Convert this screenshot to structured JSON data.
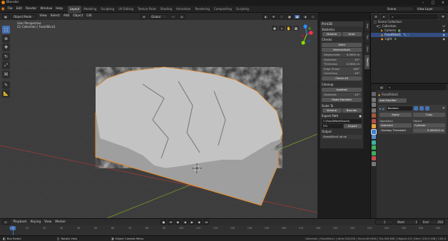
{
  "app": {
    "title": "Blender"
  },
  "topbar": {
    "menus": [
      "File",
      "Edit",
      "Render",
      "Window",
      "Help"
    ],
    "workspaces": [
      "Layout",
      "Modeling",
      "Sculpting",
      "UV Editing",
      "Texture Paint",
      "Shading",
      "Animation",
      "Rendering",
      "Compositing",
      "Scripting"
    ],
    "active_workspace": "Layout",
    "scene": "Scene",
    "view_layer": "View Layer"
  },
  "viewport": {
    "mode": "Object Mode",
    "menus": [
      "View",
      "Select",
      "Add",
      "Object"
    ],
    "gis": "GIS",
    "orientation": "Global",
    "view_name": "User Perspective",
    "collection_info": "(1) Collection | FossilSlice1"
  },
  "npanel": {
    "header": "Print3D",
    "statistics": "Statistics",
    "volume_btn": "Volume",
    "area_btn": "Area",
    "checks": "Checks",
    "solid_btn": "Solid",
    "intersections_btn": "Intersections",
    "rows": [
      {
        "label": "Degenerate",
        "value": "0.0001 m"
      },
      {
        "label": "Distorted",
        "value": "45°"
      },
      {
        "label": "Thickness",
        "value": "0.0001 m"
      },
      {
        "label": "Edge Sharp",
        "value": "160°"
      },
      {
        "label": "Overhang",
        "value": "45°"
      }
    ],
    "check_all_btn": "Check All",
    "cleanup": "Cleanup",
    "isolated_btn": "Isolated",
    "distorted_label": "Distorted",
    "distorted_value": "45°",
    "make_manifold_btn": "Make Manifold",
    "scale_to": "Scale To",
    "scale_volume_btn": "Volume",
    "bounds_btn": "Bounds",
    "export_path_label": "Export Path",
    "export_path_value": "C:\\FossilMeshRound\\",
    "format_value": "STL",
    "export_btn": "Export",
    "output": "Output",
    "output_value": "\\FossilSlice1.stl ok"
  },
  "sidetabs": [
    "Item",
    "Tool",
    "View",
    "Print3D"
  ],
  "outliner": {
    "title": "Scene Collection",
    "items": [
      {
        "label": "Collection",
        "indent": 1,
        "selected": false
      },
      {
        "label": "Camera",
        "indent": 2,
        "selected": false
      },
      {
        "label": "FossilSlice1",
        "indent": 2,
        "selected": true
      },
      {
        "label": "Light",
        "indent": 2,
        "selected": false
      }
    ]
  },
  "props": {
    "object_name": "FossilSlice1",
    "add_modifier": "Add Modifier",
    "modifier_name": "Boolean",
    "apply_btn": "Apply",
    "copy_btn": "Copy",
    "operation_label": "Operation",
    "object_label": "Object",
    "operation_value": "Intersect",
    "object_value": "Cylinder",
    "overlap_label": "Overlap Threshold",
    "overlap_value": "0.000001 m"
  },
  "timeline": {
    "menus": [
      "Playback",
      "Keying",
      "View",
      "Marker"
    ],
    "current_frame": "1",
    "start_label": "Start",
    "start_value": "1",
    "end_label": "End",
    "end_value": "250",
    "ticks": [
      "0",
      "10",
      "20",
      "30",
      "40",
      "50",
      "60",
      "70",
      "80",
      "90",
      "100",
      "110",
      "120",
      "130",
      "140",
      "150",
      "160",
      "170",
      "180",
      "190",
      "200",
      "210",
      "220",
      "230",
      "240",
      "250"
    ]
  },
  "status": {
    "select": "Box Select",
    "rotate": "Rotate View",
    "context": "Object Context Menu",
    "stats": "Collection | FossilSlice1 | Verts:204,830 | Faces:409,656 | Tris:409,656 | Objects:1/3 | Mem: 200.5 MiB | 2.83.0"
  },
  "colors": {
    "accent": "#4772b3",
    "selection": "#e98b2a",
    "mesh": "#a9a9a9"
  }
}
